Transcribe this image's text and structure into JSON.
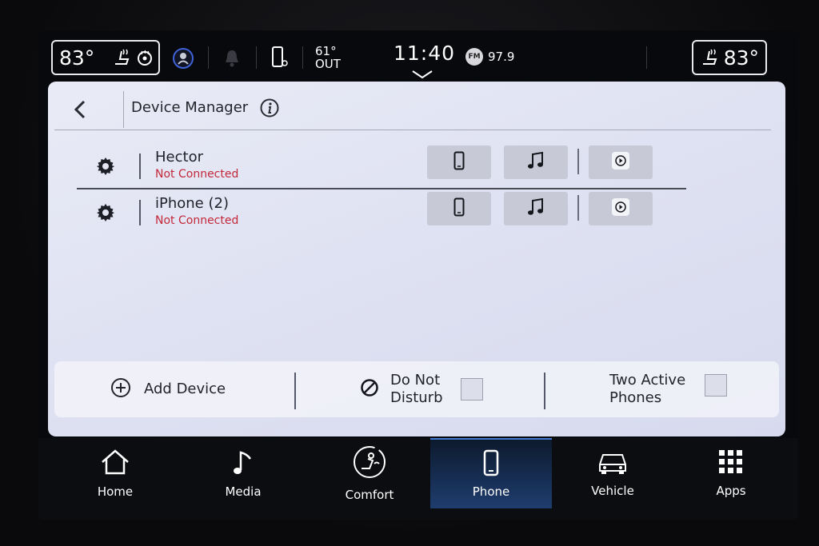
{
  "status_bar": {
    "driver_temp": "83°",
    "passenger_temp": "83°",
    "outside_temp": "61°",
    "outside_label": "OUT",
    "time": "11:40",
    "radio_band": "FM",
    "radio_freq": "97.9"
  },
  "header": {
    "title": "Device Manager"
  },
  "devices": [
    {
      "name": "Hector",
      "status": "Not Connected"
    },
    {
      "name": "iPhone (2)",
      "status": "Not Connected"
    }
  ],
  "toolbar": {
    "add_device_label": "Add Device",
    "dnd_line1": "Do Not",
    "dnd_line2": "Disturb",
    "two_active_line1": "Two Active",
    "two_active_line2": "Phones"
  },
  "nav": {
    "items": [
      {
        "label": "Home",
        "icon": "home-icon"
      },
      {
        "label": "Media",
        "icon": "music-note-icon"
      },
      {
        "label": "Comfort",
        "icon": "climate-icon"
      },
      {
        "label": "Phone",
        "icon": "phone-icon"
      },
      {
        "label": "Vehicle",
        "icon": "car-icon"
      },
      {
        "label": "Apps",
        "icon": "grid-icon"
      }
    ],
    "active": "Phone"
  },
  "colors": {
    "not_connected": "#c3283a",
    "active_tab": "#1e3d6e",
    "panel_bg": "#e4e6f4"
  }
}
